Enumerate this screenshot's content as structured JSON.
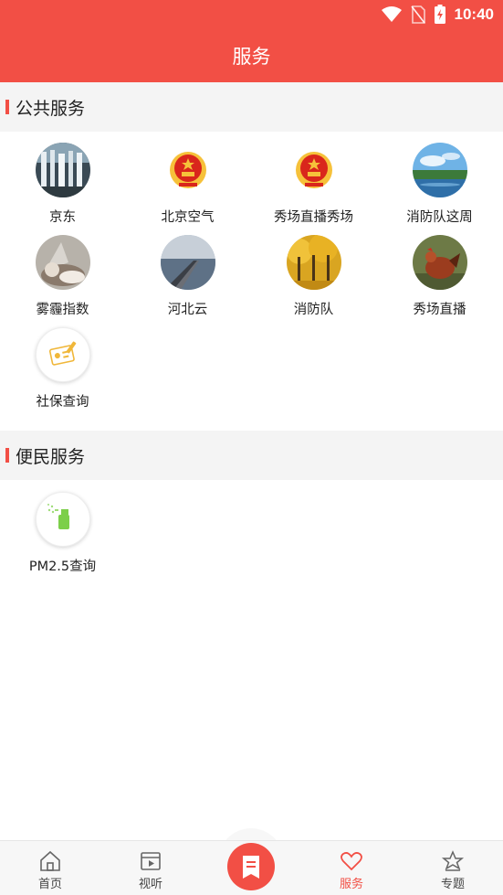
{
  "status_bar": {
    "time": "10:40"
  },
  "header": {
    "title": "服务"
  },
  "sections": [
    {
      "title": "公共服务",
      "items": [
        {
          "label": "京东",
          "icon": "waterfall-photo"
        },
        {
          "label": "北京空气",
          "icon": "national-emblem"
        },
        {
          "label": "秀场直播秀场",
          "icon": "national-emblem"
        },
        {
          "label": "消防队这周",
          "icon": "lake-photo"
        },
        {
          "label": "雾霾指数",
          "icon": "cat-photo"
        },
        {
          "label": "河北云",
          "icon": "pier-photo"
        },
        {
          "label": "消防队",
          "icon": "autumn-trees-photo"
        },
        {
          "label": "秀场直播",
          "icon": "rooster-photo"
        },
        {
          "label": "社保查询",
          "icon": "id-card-icon"
        }
      ]
    },
    {
      "title": "便民服务",
      "items": [
        {
          "label": "PM2.5查询",
          "icon": "spray-bottle-icon"
        }
      ]
    }
  ],
  "tabbar": {
    "tabs": [
      {
        "label": "首页",
        "icon": "home-icon"
      },
      {
        "label": "视听",
        "icon": "video-icon"
      },
      {
        "label": "",
        "icon": "bookmark-icon"
      },
      {
        "label": "服务",
        "icon": "heart-icon",
        "active": true
      },
      {
        "label": "专题",
        "icon": "star-icon"
      }
    ]
  },
  "colors": {
    "accent": "#f24f45",
    "section_bg": "#f4f4f4",
    "tabbar_bg": "#f7f7f7"
  }
}
